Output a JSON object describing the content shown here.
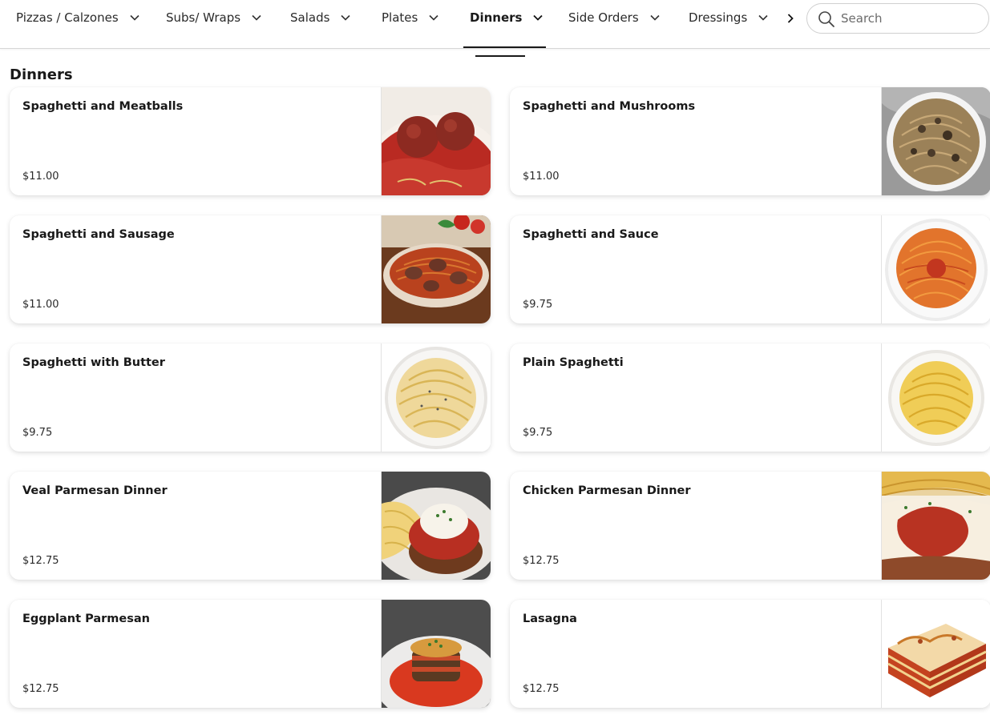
{
  "nav": {
    "tabs": [
      {
        "label": "Pizzas / Calzones"
      },
      {
        "label": "Subs/ Wraps"
      },
      {
        "label": "Salads"
      },
      {
        "label": "Plates"
      },
      {
        "label": "Dinners"
      },
      {
        "label": "Side Orders"
      },
      {
        "label": "Dressings"
      }
    ],
    "active_tab": "Dinners",
    "more_icon": "chevron-right-icon",
    "search_placeholder": "Search",
    "search_icon": "search-icon"
  },
  "section": {
    "title": "Dinners"
  },
  "items": [
    {
      "name": "Spaghetti and Meatballs",
      "price": "$11.00",
      "image": "spaghetti-meatballs-photo"
    },
    {
      "name": "Spaghetti and Mushrooms",
      "price": "$11.00",
      "image": "spaghetti-mushrooms-photo"
    },
    {
      "name": "Spaghetti and Sausage",
      "price": "$11.00",
      "image": "spaghetti-sausage-photo"
    },
    {
      "name": "Spaghetti and Sauce",
      "price": "$9.75",
      "image": "spaghetti-sauce-photo"
    },
    {
      "name": "Spaghetti with Butter",
      "price": "$9.75",
      "image": "spaghetti-butter-photo"
    },
    {
      "name": "Plain Spaghetti",
      "price": "$9.75",
      "image": "plain-spaghetti-photo"
    },
    {
      "name": "Veal Parmesan Dinner",
      "price": "$12.75",
      "image": "veal-parmesan-photo"
    },
    {
      "name": "Chicken Parmesan Dinner",
      "price": "$12.75",
      "image": "chicken-parmesan-photo"
    },
    {
      "name": "Eggplant Parmesan",
      "price": "$12.75",
      "image": "eggplant-parmesan-photo"
    },
    {
      "name": "Lasagna",
      "price": "$12.75",
      "image": "lasagna-photo"
    }
  ],
  "colors": {
    "text": "#191919",
    "border": "#d6d6d6",
    "sauce": "#c2362b",
    "pasta": "#e9c766"
  }
}
